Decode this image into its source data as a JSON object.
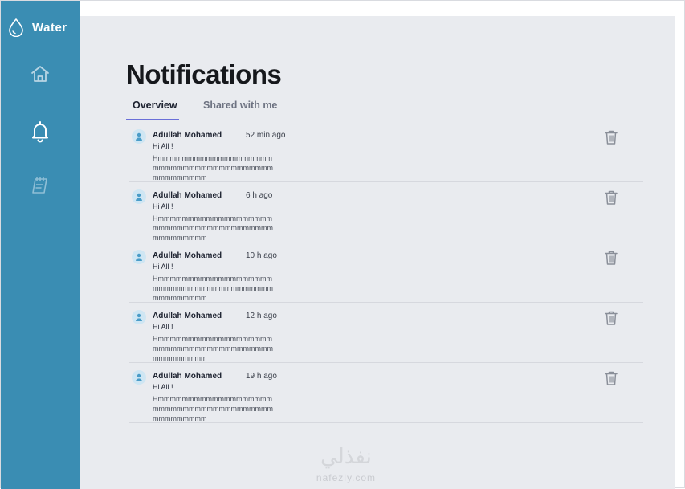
{
  "app": {
    "name": "Water"
  },
  "sidebar": {
    "items": [
      {
        "id": "home",
        "icon": "home-icon"
      },
      {
        "id": "notifications",
        "icon": "bell-icon",
        "active": true
      },
      {
        "id": "notes",
        "icon": "notebook-icon"
      }
    ]
  },
  "page": {
    "title": "Notifications"
  },
  "tabs": [
    {
      "label": "Overview",
      "active": true
    },
    {
      "label": "Shared with me",
      "active": false
    }
  ],
  "notifications": [
    {
      "sender": "Adullah Mohamed",
      "time": "52 min  ago",
      "greeting": "Hi All !",
      "body": "Hmmmmmmmmmmmmmmmmmmmmmmmmmmmmmmmmmmmmmmmmmmmmmmmm"
    },
    {
      "sender": "Adullah Mohamed",
      "time": "6 h ago",
      "greeting": "Hi All !",
      "body": "Hmmmmmmmmmmmmmmmmmmmmmmmmmmmmmmmmmmmmmmmmmmmmmmmm"
    },
    {
      "sender": "Adullah Mohamed",
      "time": "10 h ago",
      "greeting": "Hi All !",
      "body": "Hmmmmmmmmmmmmmmmmmmmmmmmmmmmmmmmmmmmmmmmmmmmmmmmm"
    },
    {
      "sender": "Adullah Mohamed",
      "time": "12 h ago",
      "greeting": "Hi All !",
      "body": "Hmmmmmmmmmmmmmmmmmmmmmmmmmmmmmmmmmmmmmmmmmmmmmmmm"
    },
    {
      "sender": "Adullah Mohamed",
      "time": "19 h ago",
      "greeting": "Hi All !",
      "body": "Hmmmmmmmmmmmmmmmmmmmmmmmmmmmmmmmmmmmmmmmmmmmmmmmm"
    }
  ],
  "icons": {
    "avatar": "user-icon",
    "delete": "trash-icon",
    "logo": "water-drop-icon"
  },
  "watermark": {
    "arabic": "نفذلي",
    "latin": "nafezly.com"
  },
  "colors": {
    "sidebar": "#3a8db3",
    "background": "#e9ebef",
    "tab_accent": "#6a6fd8"
  }
}
